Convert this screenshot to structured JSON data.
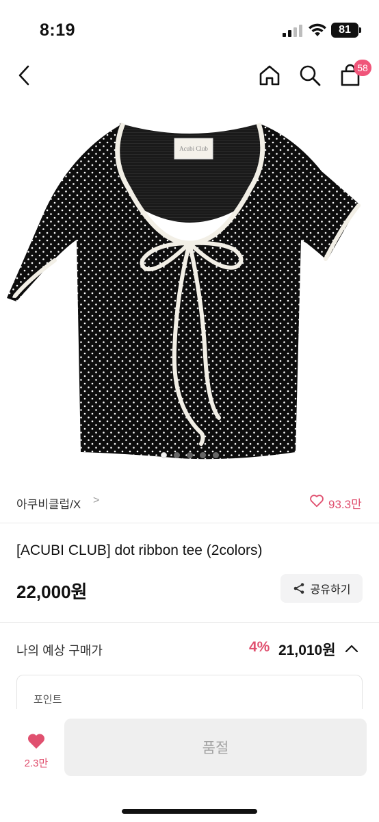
{
  "status_bar": {
    "time": "8:19",
    "battery": "81"
  },
  "nav": {
    "cart_badge": "58"
  },
  "gallery": {
    "total_images": 5,
    "active_index": 0
  },
  "brand": {
    "name": "아쿠비클럽/X",
    "chevron": ">",
    "like_count": "93.3만"
  },
  "product": {
    "title": "[ACUBI CLUB] dot ribbon tee (2colors)",
    "price": "22,000원",
    "tag_text": "Acubi Club"
  },
  "share": {
    "label": "공유하기"
  },
  "expected_price": {
    "label": "나의 예상 구매가",
    "rate": "4%",
    "price": "21,010원"
  },
  "point": {
    "label": "포인트"
  },
  "bottom_bar": {
    "wish_count": "2.3만",
    "soldout_label": "품절"
  },
  "colors": {
    "accent": "#e0506f",
    "badge": "#f0557a",
    "disabled_bg": "#efefef",
    "disabled_text": "#a3a3a3"
  }
}
